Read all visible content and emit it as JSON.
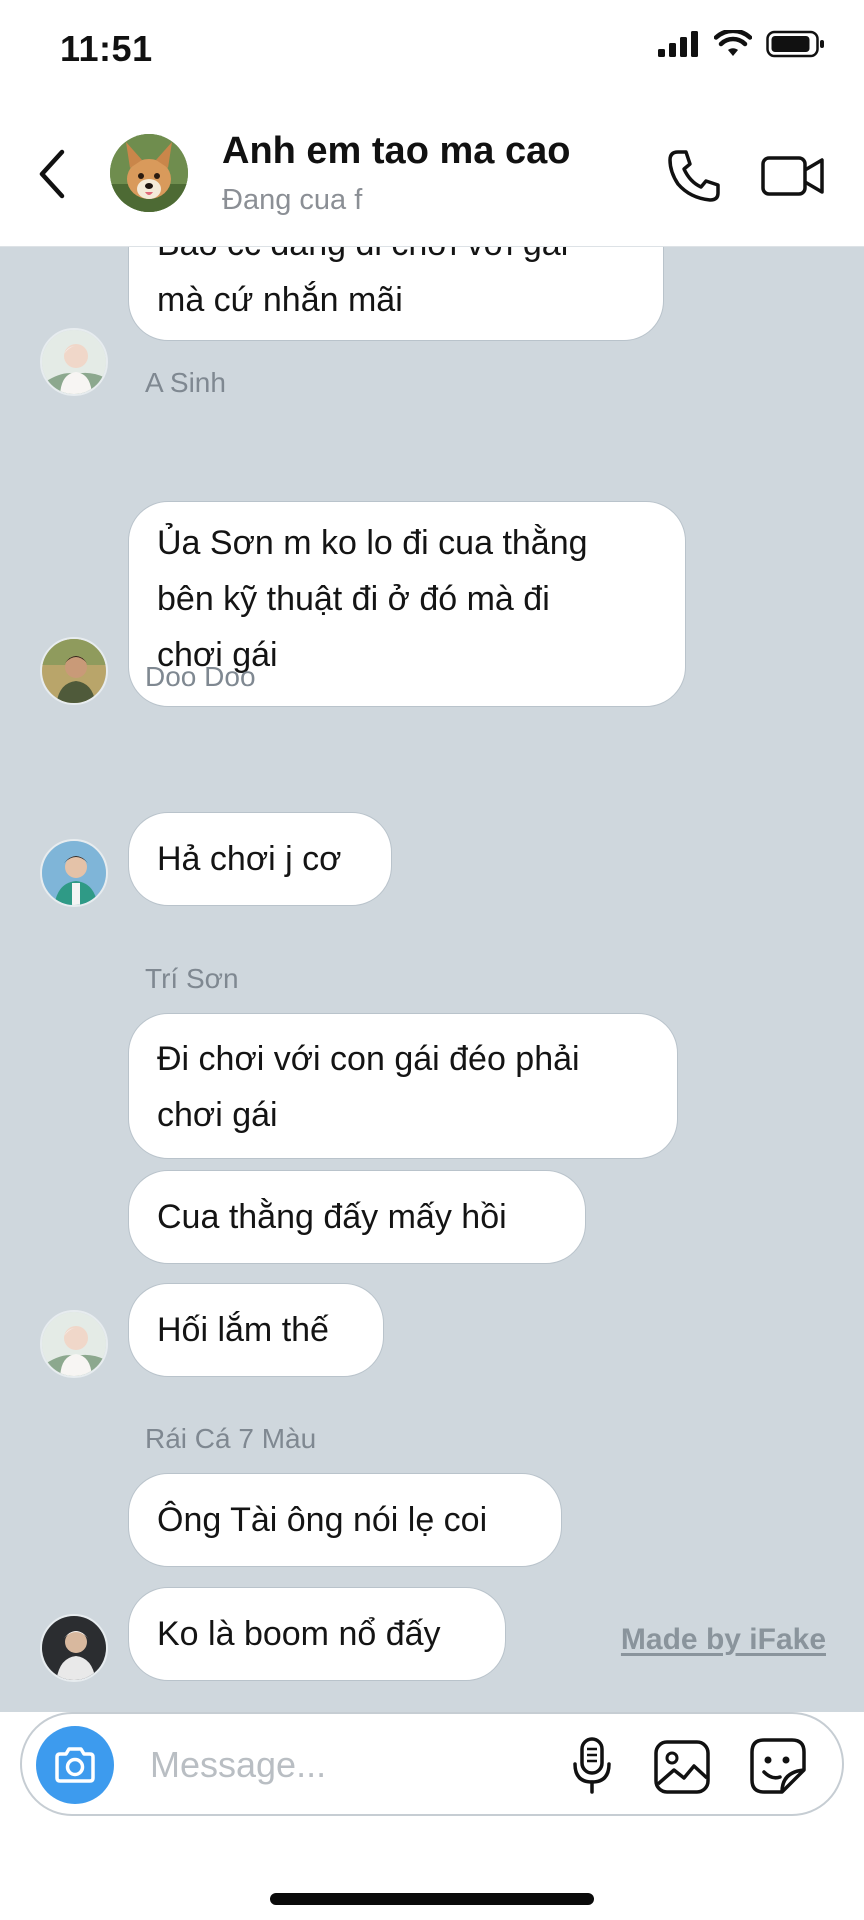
{
  "status_bar": {
    "time": "11:51"
  },
  "header": {
    "title": "Anh em tao ma cao",
    "subtitle": "Đang cua f"
  },
  "messages": [
    {
      "sender": "",
      "lines": [
        "Báo cc đang đi chơi với gái",
        "mà cứ nhắn mãi"
      ]
    },
    {
      "sender": "A Sinh",
      "lines": [
        "Ủa Sơn m ko lo đi cua thằng",
        "bên kỹ thuật đi ở đó mà đi",
        "chơi gái"
      ]
    },
    {
      "sender": "Doo Doo",
      "lines": [
        "Hả chơi j cơ"
      ]
    },
    {
      "sender": "Trí Sơn",
      "lines": [
        "Đi chơi với con gái đéo phải",
        "chơi gái"
      ]
    },
    {
      "sender": "",
      "lines": [
        "Cua thằng đấy mấy hồi"
      ]
    },
    {
      "sender": "",
      "lines": [
        "Hối lắm thế"
      ]
    },
    {
      "sender": "Rái Cá 7 Màu",
      "lines": [
        "Ông Tài ông nói lẹ coi"
      ]
    },
    {
      "sender": "",
      "lines": [
        "Ko là boom nổ đấy"
      ]
    }
  ],
  "watermark": "Made by iFake",
  "composer": {
    "placeholder": "Message..."
  },
  "icons": {
    "back": "chevron-left-icon",
    "call": "phone-icon",
    "video": "video-camera-icon",
    "camera": "camera-icon",
    "mic": "microphone-icon",
    "photo": "image-icon",
    "sticker": "sticker-icon"
  },
  "colors": {
    "chat_background": "#cfd7dd",
    "bubble_background": "#ffffff",
    "accent_blue": "#3d9bee",
    "secondary_text": "#8b8f95"
  }
}
